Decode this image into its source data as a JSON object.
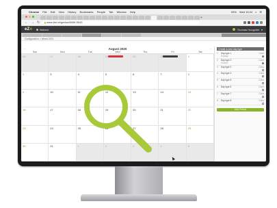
{
  "menubar": {
    "app": "Chrome",
    "items": [
      "File",
      "Edit",
      "View",
      "History",
      "Bookmarks",
      "People",
      "Tab",
      "Window",
      "Help"
    ],
    "battery": "93%",
    "clock": "Wed 15:24"
  },
  "browser": {
    "url": "www.ibcl.nl/gedoo/8469-5043"
  },
  "app": {
    "logo_prefix": "eZ",
    "logo_o": "o",
    "logo_suffix": "",
    "nav_label": "Beheer",
    "user": "Thomas Hoogvliet"
  },
  "breadcrumb": "Configuration > Week 2021",
  "calendar": {
    "month_title": "August 2020",
    "weekdays": [
      "Sun",
      "Mon",
      "Tue",
      "Wed",
      "Thu",
      "Fri",
      "Sat"
    ],
    "days": [
      {
        "n": "26",
        "other": true
      },
      {
        "n": "27",
        "other": true
      },
      {
        "n": "28",
        "other": true
      },
      {
        "n": "29",
        "other": true
      },
      {
        "n": "30",
        "other": true
      },
      {
        "n": "31",
        "other": true
      },
      {
        "n": "1",
        "weekend": true
      },
      {
        "n": "2",
        "weekend": true
      },
      {
        "n": "3"
      },
      {
        "n": "4"
      },
      {
        "n": "5"
      },
      {
        "n": "6"
      },
      {
        "n": "7"
      },
      {
        "n": "8",
        "weekend": true
      },
      {
        "n": "9",
        "weekend": true
      },
      {
        "n": "10"
      },
      {
        "n": "11"
      },
      {
        "n": "12"
      },
      {
        "n": "13"
      },
      {
        "n": "14"
      },
      {
        "n": "15",
        "weekend": true
      },
      {
        "n": "16",
        "weekend": true
      },
      {
        "n": "17"
      },
      {
        "n": "18"
      },
      {
        "n": "19"
      },
      {
        "n": "20"
      },
      {
        "n": "21"
      },
      {
        "n": "22",
        "weekend": true
      },
      {
        "n": "23",
        "weekend": true
      },
      {
        "n": "24"
      },
      {
        "n": "25"
      },
      {
        "n": "26"
      },
      {
        "n": "27"
      },
      {
        "n": "28"
      },
      {
        "n": "29",
        "weekend": true
      },
      {
        "n": "30",
        "weekend": true
      },
      {
        "n": "31"
      },
      {
        "n": "1",
        "other": true
      },
      {
        "n": "2",
        "other": true
      },
      {
        "n": "3",
        "other": true
      },
      {
        "n": "4",
        "other": true
      },
      {
        "n": "5",
        "other": true
      }
    ]
  },
  "panel": {
    "header": "Create a new day type",
    "items": [
      {
        "num": "1",
        "label": "Day type 1",
        "sub": "Holiday",
        "right": "Color",
        "color": "#c9262f"
      },
      {
        "num": "2",
        "label": "Day type 2",
        "sub": "Closed",
        "right": "Color",
        "color": "#3a3a3c"
      },
      {
        "num": "3",
        "label": "Day type 3",
        "sub": "",
        "right": "Color",
        "color": "#e8e8e8"
      },
      {
        "num": "4",
        "label": "Day type 4",
        "sub": "",
        "right": "Color",
        "color": "#7ec8e3"
      },
      {
        "num": "5",
        "label": "Day type 5",
        "sub": "",
        "right": "Color",
        "color": "#f2e94e"
      },
      {
        "num": "6",
        "label": "Day type 6",
        "sub": "",
        "right": "Color",
        "color": "#f4a3c4"
      },
      {
        "num": "7",
        "label": "Day type 7",
        "sub": "",
        "right": "Color",
        "color": "#d9f0c6"
      },
      {
        "num": "8",
        "label": "Day type 8",
        "sub": "",
        "right": "Color",
        "color": "#c9e6f5"
      }
    ],
    "button": "Add Period"
  },
  "colors": {
    "accent": "#8ab52b",
    "holiday": "#d9303b",
    "closed": "#3a3a3c"
  }
}
